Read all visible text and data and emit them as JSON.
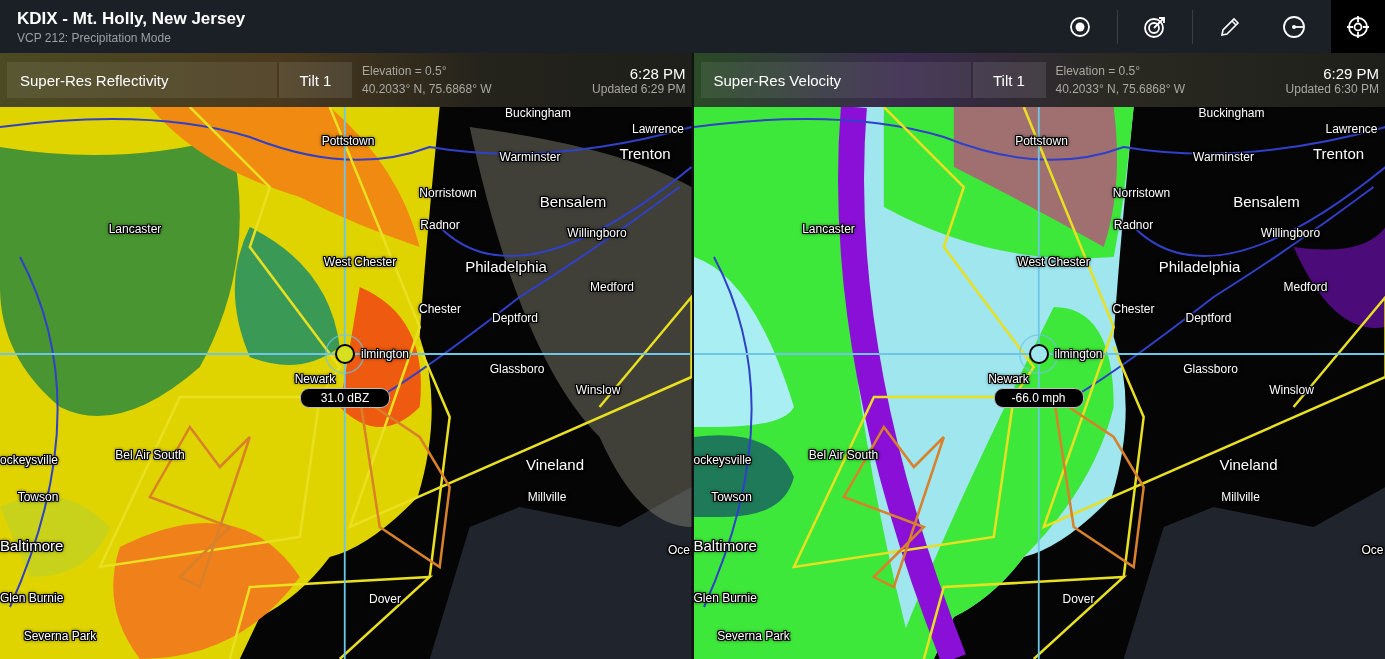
{
  "window": {
    "title": "KDIX - Mt. Holly, New Jersey",
    "subtitle": "VCP 212: Precipitation Mode"
  },
  "toolbar": [
    {
      "selected": false
    },
    {
      "selected": false
    },
    {
      "selected": false
    },
    {
      "selected": false
    },
    {
      "selected": true
    }
  ],
  "panels": [
    {
      "kind": "reflectivity",
      "product": "Super-Res Reflectivity",
      "tilt": "Tilt 1",
      "elevation": "Elevation = 0.5°",
      "coordinates": "40.2033° N, 75.6868° W",
      "time": "6:28 PM",
      "updated": "Updated 6:29 PM",
      "reading": "31.0 dBZ",
      "map_labels": [
        {
          "text": "Buckingham",
          "kind": "minor"
        },
        {
          "text": "Pottstown",
          "kind": "minor"
        },
        {
          "text": "Lawrence",
          "kind": "minor"
        },
        {
          "text": "Warminster",
          "kind": "minor"
        },
        {
          "text": "Trenton",
          "kind": "major"
        },
        {
          "text": "Norristown",
          "kind": "minor"
        },
        {
          "text": "Bensalem",
          "kind": "major"
        },
        {
          "text": "Lancaster",
          "kind": "minor"
        },
        {
          "text": "Radnor",
          "kind": "minor"
        },
        {
          "text": "Willingboro",
          "kind": "minor"
        },
        {
          "text": "West Chester",
          "kind": "minor"
        },
        {
          "text": "Philadelphia",
          "kind": "major"
        },
        {
          "text": "Medford",
          "kind": "minor"
        },
        {
          "text": "Chester",
          "kind": "minor"
        },
        {
          "text": "Deptford",
          "kind": "minor"
        },
        {
          "text": "ilmington",
          "kind": "minor"
        },
        {
          "text": "Glassboro",
          "kind": "minor"
        },
        {
          "text": "Newark",
          "kind": "minor"
        },
        {
          "text": "Winslow",
          "kind": "minor"
        },
        {
          "text": "Bel Air South",
          "kind": "minor"
        },
        {
          "text": "ockeysville",
          "kind": "minor"
        },
        {
          "text": "Vineland",
          "kind": "major"
        },
        {
          "text": "Towson",
          "kind": "minor"
        },
        {
          "text": "Millville",
          "kind": "minor"
        },
        {
          "text": "Baltimore",
          "kind": "major"
        },
        {
          "text": "Oce",
          "kind": "minor"
        },
        {
          "text": "Glen Burnie",
          "kind": "minor"
        },
        {
          "text": "Dover",
          "kind": "minor"
        },
        {
          "text": "Severna Park",
          "kind": "minor"
        }
      ]
    },
    {
      "kind": "velocity",
      "product": "Super-Res Velocity",
      "tilt": "Tilt 1",
      "elevation": "Elevation = 0.5°",
      "coordinates": "40.2033° N, 75.6868° W",
      "time": "6:29 PM",
      "updated": "Updated 6:30 PM",
      "reading": "-66.0 mph",
      "map_labels": [
        {
          "text": "Buckingham",
          "kind": "minor"
        },
        {
          "text": "Pottstown",
          "kind": "minor"
        },
        {
          "text": "Lawrence",
          "kind": "minor"
        },
        {
          "text": "Warminster",
          "kind": "minor"
        },
        {
          "text": "Trenton",
          "kind": "major"
        },
        {
          "text": "Norristown",
          "kind": "minor"
        },
        {
          "text": "Bensalem",
          "kind": "major"
        },
        {
          "text": "Lancaster",
          "kind": "minor"
        },
        {
          "text": "Radnor",
          "kind": "minor"
        },
        {
          "text": "Willingboro",
          "kind": "minor"
        },
        {
          "text": "West Chester",
          "kind": "minor"
        },
        {
          "text": "Philadelphia",
          "kind": "major"
        },
        {
          "text": "Medford",
          "kind": "minor"
        },
        {
          "text": "Chester",
          "kind": "minor"
        },
        {
          "text": "Deptford",
          "kind": "minor"
        },
        {
          "text": "ilmington",
          "kind": "minor"
        },
        {
          "text": "Glassboro",
          "kind": "minor"
        },
        {
          "text": "Newark",
          "kind": "minor"
        },
        {
          "text": "Winslow",
          "kind": "minor"
        },
        {
          "text": "Bel Air South",
          "kind": "minor"
        },
        {
          "text": "ockeysville",
          "kind": "minor"
        },
        {
          "text": "Vineland",
          "kind": "major"
        },
        {
          "text": "Towson",
          "kind": "minor"
        },
        {
          "text": "Millville",
          "kind": "minor"
        },
        {
          "text": "Baltimore",
          "kind": "major"
        },
        {
          "text": "Oce",
          "kind": "minor"
        },
        {
          "text": "Glen Burnie",
          "kind": "minor"
        },
        {
          "text": "Dover",
          "kind": "minor"
        },
        {
          "text": "Severna Park",
          "kind": "minor"
        }
      ]
    }
  ]
}
